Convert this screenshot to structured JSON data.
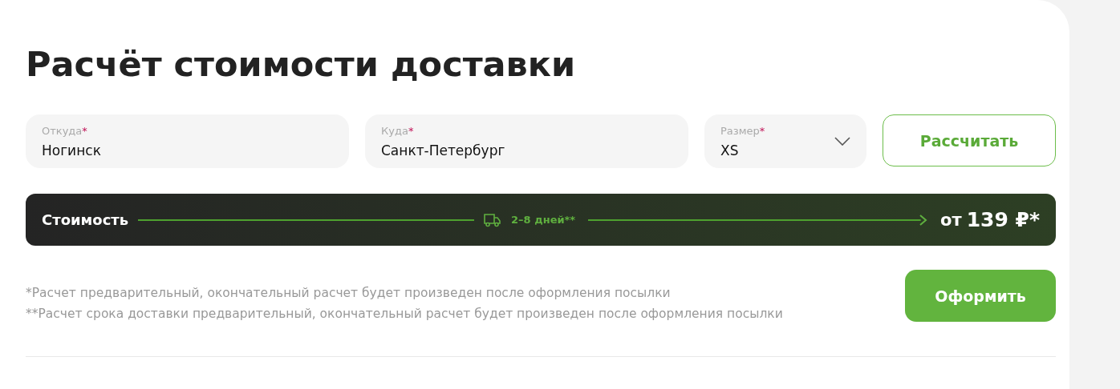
{
  "title": "Расчёт стоимости доставки",
  "fields": [
    {
      "kind": "text",
      "label": "Откуда",
      "mark": "*",
      "value": "Ногинск"
    },
    {
      "kind": "text",
      "label": "Куда",
      "mark": "*",
      "value": "Санкт-Петербург"
    },
    {
      "kind": "select",
      "label": "Размер",
      "mark": "*",
      "value": "XS"
    }
  ],
  "calculate_button": "Рассчитать",
  "cost_bar": {
    "label": "Стоимость",
    "duration": "2–8 дней**",
    "price_prefix": "от",
    "price": "139 ₽*"
  },
  "notes": [
    "*Расчет предварительный, окончательный расчет будет произведен после оформления посылки",
    "**Расчет срока доставки предварительный, окончательный расчет будет произведен после оформления посылки"
  ],
  "order_button": "Оформить"
}
